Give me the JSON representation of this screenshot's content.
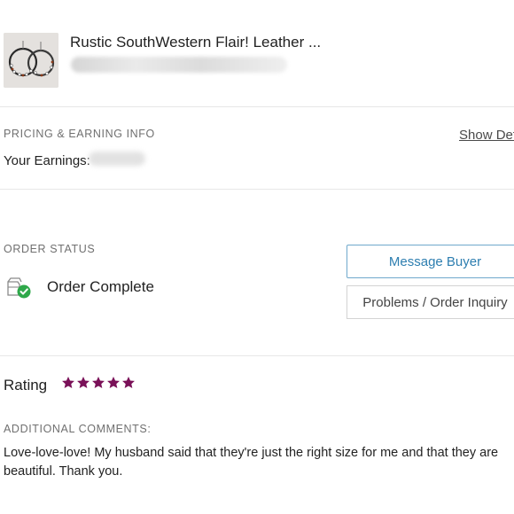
{
  "item": {
    "title": "Rustic SouthWestern Flair! Leather ...",
    "thumbnail_icon": "earrings-product-photo"
  },
  "pricing": {
    "section_label": "PRICING & EARNING INFO",
    "show_details_label": "Show Det",
    "earnings_label": "Your Earnings:"
  },
  "order_status": {
    "section_label": "ORDER STATUS",
    "status_text": "Order Complete",
    "status_icon": "package-check-icon",
    "message_buyer_label": "Message Buyer",
    "problems_label": "Problems / Order Inquiry"
  },
  "rating": {
    "label": "Rating",
    "stars": 5,
    "max_stars": 5,
    "star_color": "#7a1158"
  },
  "comments": {
    "section_label": "ADDITIONAL COMMENTS:",
    "text": "Love-love-love! My husband said that they're just the right size for me and that they are beautiful. Thank you."
  },
  "colors": {
    "accent_button_text": "#2d7eb0",
    "accent_button_border": "#6fa9cc",
    "check_green": "#2ea84a"
  }
}
